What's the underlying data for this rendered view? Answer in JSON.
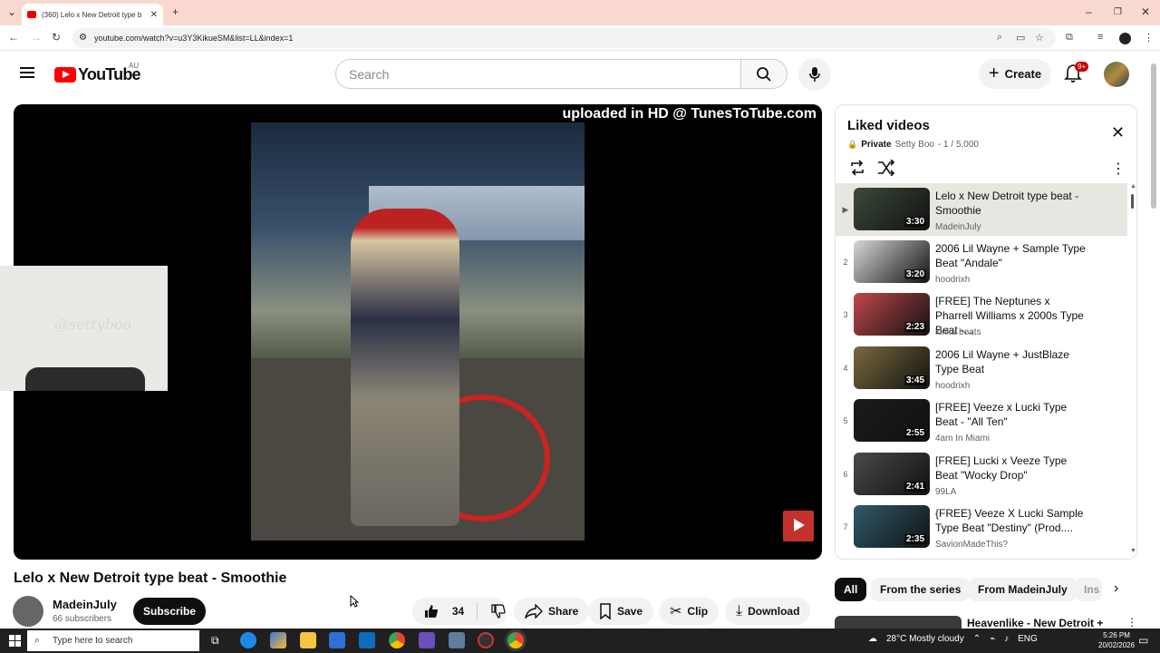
{
  "browser": {
    "tab_title": "(360) Lelo x New Detroit type b",
    "url": "youtube.com/watch?v=u3Y3KikueSM&list=LL&index=1"
  },
  "header": {
    "logo_text": "YouTube",
    "country_code": "AU",
    "search_placeholder": "Search",
    "create_label": "Create",
    "notification_badge": "9+"
  },
  "player": {
    "watermark": "uploaded in HD @ TunesToTube.com",
    "webcam_signature": "@settyboo"
  },
  "video": {
    "title": "Lelo x New Detroit type beat - Smoothie",
    "channel": "MadeinJuly",
    "subscribers": "66 subscribers",
    "subscribe_label": "Subscribe",
    "likes": "34",
    "share_label": "Share",
    "save_label": "Save",
    "clip_label": "Clip",
    "download_label": "Download"
  },
  "playlist": {
    "title": "Liked videos",
    "privacy": "Private",
    "owner": "Setty Boo",
    "position": "- 1 / 5,000",
    "current_marker": "▶",
    "items": [
      {
        "idx": "",
        "title": "Lelo x New Detroit type beat - Smoothie",
        "channel": "MadeinJuly",
        "duration": "3:30",
        "color": "#3b4a3a"
      },
      {
        "idx": "2",
        "title": "2006 Lil Wayne + Sample Type Beat \"Andale\"",
        "channel": "hoodrixh",
        "duration": "3:20",
        "color": "#d8d8d8"
      },
      {
        "idx": "3",
        "title": "[FREE] The Neptunes x Pharrell Williams x 2000s Type Beat -...",
        "channel": "kiriku beats",
        "duration": "2:23",
        "color": "#c0474a"
      },
      {
        "idx": "4",
        "title": "2006 Lil Wayne + JustBlaze Type Beat",
        "channel": "hoodrixh",
        "duration": "3:45",
        "color": "#7a6a3e"
      },
      {
        "idx": "5",
        "title": "[FREE] Veeze x Lucki Type Beat - \"All Ten\"",
        "channel": "4am In Miami",
        "duration": "2:55",
        "color": "#1b1b1b"
      },
      {
        "idx": "6",
        "title": "[FREE] Lucki x Veeze Type Beat \"Wocky Drop\"",
        "channel": "99LA",
        "duration": "2:41",
        "color": "#4a4a48"
      },
      {
        "idx": "7",
        "title": "{FREE} Veeze X Lucki Sample Type Beat \"Destiny\" (Prod....",
        "channel": "SavionMadeThis?",
        "duration": "2:35",
        "color": "#2f5a6a"
      }
    ]
  },
  "chips": [
    "All",
    "From the series",
    "From MadeinJuly",
    "Ins"
  ],
  "recommendation": {
    "title": "Heavenlike - New Detroit +"
  },
  "taskbar": {
    "search_placeholder": "Type here to search",
    "weather": "28°C  Mostly cloudy",
    "lang": "ENG",
    "time": "5:26 PM",
    "date": "20/02/2026"
  }
}
